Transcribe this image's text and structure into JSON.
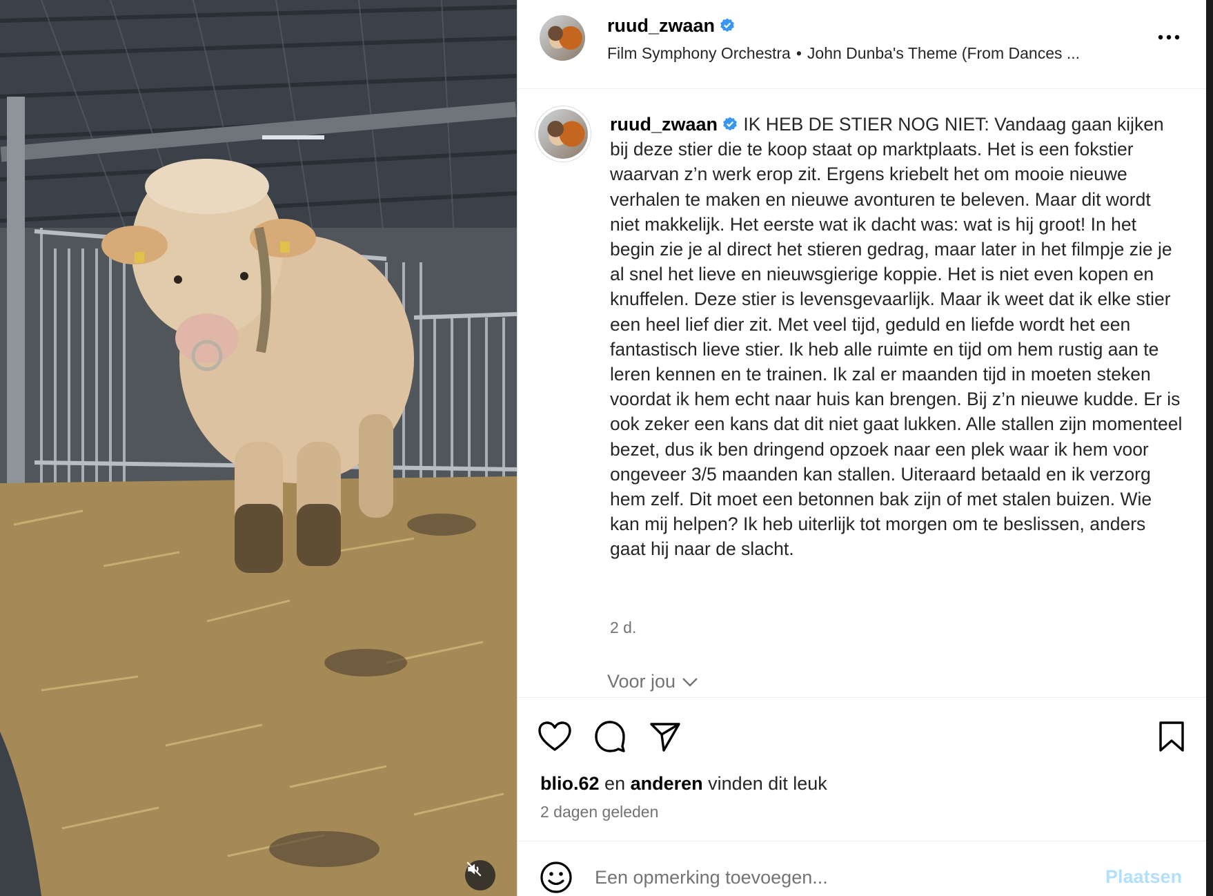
{
  "post": {
    "media": {
      "description_icon": "muted-speaker-icon"
    },
    "author": {
      "username": "ruud_zwaan",
      "verified_icon": "verified-badge-icon"
    },
    "audio": {
      "artist": "Film Symphony Orchestra",
      "separator": "•",
      "track": "John Dunba's Theme (From Dances ..."
    },
    "caption": {
      "username": "ruud_zwaan",
      "text": "IK HEB DE STIER NOG NIET: Vandaag gaan kijken bij deze stier die te koop staat op marktplaats. Het is een fokstier waarvan z’n werk erop zit. Ergens kriebelt het om mooie nieuwe verhalen te maken en nieuwe avonturen te beleven. Maar dit wordt niet makkelijk. Het eerste wat ik dacht was: wat is hij groot! In het begin zie je al direct het stieren gedrag, maar later in het filmpje zie je al snel het lieve en nieuwsgierige koppie. Het is niet even kopen en knuffelen. Deze stier is levensgevaarlijk. Maar ik weet dat ik elke stier een heel lief dier zit. Met veel tijd, geduld en liefde wordt het een fantastisch lieve stier. Ik heb alle ruimte en tijd om hem rustig aan te leren kennen en te trainen. Ik zal er maanden tijd in moeten steken voordat ik hem echt naar huis kan brengen. Bij z’n nieuwe kudde. Er is ook zeker een kans dat dit niet gaat lukken. Alle stallen zijn momenteel bezet, dus ik ben dringend opzoek naar een plek waar ik hem voor ongeveer 3/5 maanden kan stallen. Uiteraard betaald en ik verzorg hem zelf. Dit moet een betonnen bak zijn of met stalen buizen. Wie kan mij helpen? Ik heb uiterlijk tot morgen om te beslissen, anders gaat hij naar de slacht.",
      "time_ago": "2 d."
    },
    "for_you": "Voor jou",
    "actions": {
      "like_icon": "heart-icon",
      "comment_icon": "comment-icon",
      "share_icon": "send-icon",
      "save_icon": "bookmark-icon"
    },
    "likes": {
      "first_user": "blio.62",
      "connector": "en",
      "others": "anderen",
      "suffix": "vinden dit leuk"
    },
    "posted": "2 dagen geleden",
    "comment": {
      "placeholder": "Een opmerking toevoegen...",
      "submit_label": "Plaatsen",
      "emoji_icon": "smiley-icon"
    }
  }
}
